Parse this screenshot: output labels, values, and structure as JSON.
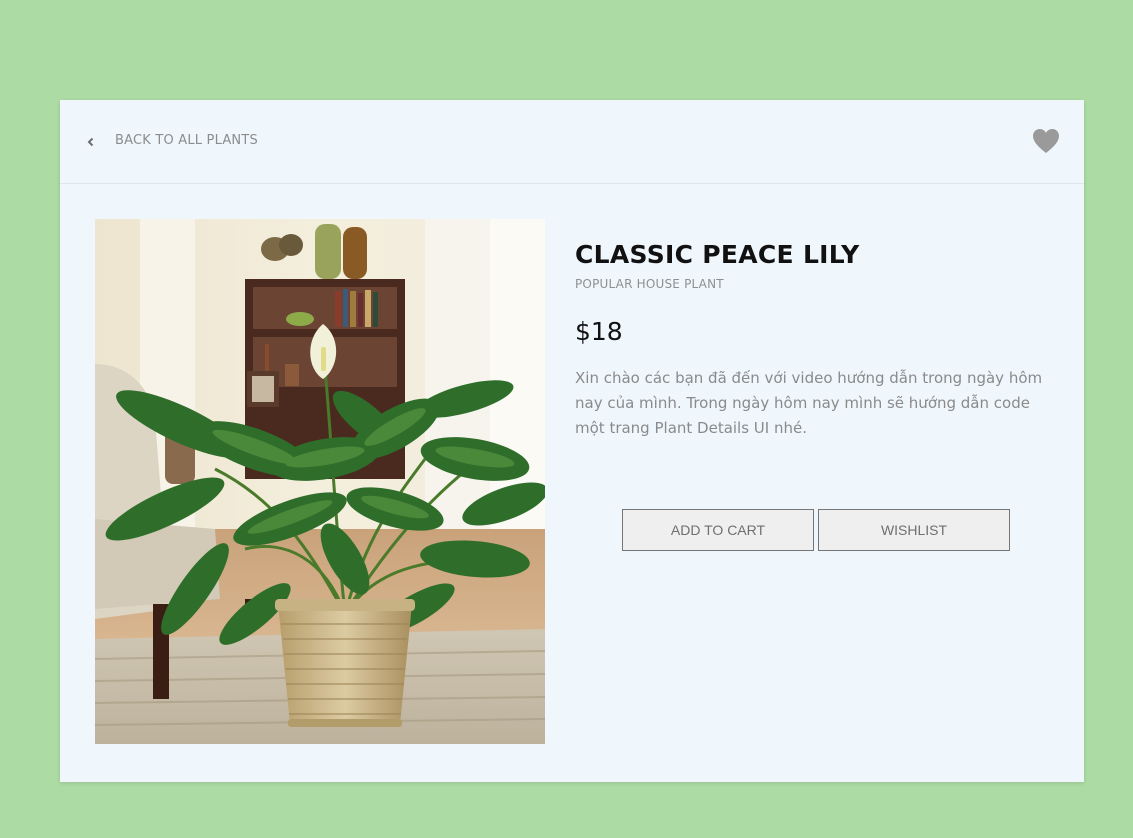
{
  "header": {
    "back_label": "BACK TO ALL PLANTS"
  },
  "product": {
    "title": "CLASSIC PEACE LILY",
    "subtitle": "POPULAR HOUSE PLANT",
    "price": "$18",
    "description": "Xin chào các bạn đã đến với video hướng dẫn trong ngày hôm nay của mình. Trong ngày hôm nay mình sẽ hướng dẫn code một trang Plant Details UI nhé."
  },
  "actions": {
    "add_to_cart": "ADD TO CART",
    "wishlist": "WISHLIST"
  },
  "icons": {
    "back": "chevron-left-icon",
    "favorite": "heart-icon"
  },
  "colors": {
    "background": "#acdba3",
    "card": "#eff7fd",
    "heart": "#9a9a9a",
    "muted_text": "#8a8a8a"
  }
}
